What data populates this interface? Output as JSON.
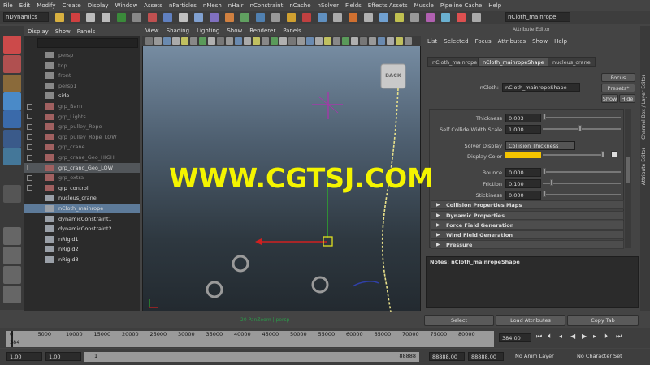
{
  "menubar": [
    "File",
    "Edit",
    "Modify",
    "Create",
    "Display",
    "Window",
    "Assets",
    "nParticles",
    "nMesh",
    "nHair",
    "nConstraint",
    "nCache",
    "nSolver",
    "Fields",
    "Effects Assets",
    "Muscle",
    "Pipeline Cache",
    "Help"
  ],
  "status": {
    "mode": "nDynamics",
    "object_field": "nCloth_mainrope"
  },
  "outliner": {
    "menu": [
      "Display",
      "Show",
      "Panels"
    ],
    "items": [
      {
        "label": "persp",
        "kind": "camera",
        "dim": true,
        "expand": false
      },
      {
        "label": "top",
        "kind": "camera",
        "dim": true,
        "expand": false
      },
      {
        "label": "front",
        "kind": "camera",
        "dim": true,
        "expand": false
      },
      {
        "label": "persp1",
        "kind": "camera",
        "dim": true,
        "expand": false
      },
      {
        "label": "side",
        "kind": "camera",
        "dim": false,
        "expand": false
      },
      {
        "label": "grp_Barn",
        "kind": "group",
        "dim": true,
        "expand": true
      },
      {
        "label": "grp_Lights",
        "kind": "group",
        "dim": true,
        "expand": true
      },
      {
        "label": "grp_pulley_Rope",
        "kind": "group",
        "dim": true,
        "expand": true
      },
      {
        "label": "grp_pulley_Rope_LOW",
        "kind": "group",
        "dim": true,
        "expand": true
      },
      {
        "label": "grp_crane",
        "kind": "group",
        "dim": true,
        "expand": true
      },
      {
        "label": "grp_crane_Geo_HIGH",
        "kind": "group",
        "dim": true,
        "expand": true
      },
      {
        "label": "grp_crand_Geo_LOW",
        "kind": "group",
        "dim": false,
        "expand": true,
        "hl": "row"
      },
      {
        "label": "grp_extra",
        "kind": "group",
        "dim": true,
        "expand": true
      },
      {
        "label": "grp_control",
        "kind": "group",
        "dim": false,
        "expand": true
      },
      {
        "label": "nucleus_crane",
        "kind": "node",
        "dim": false,
        "expand": false
      },
      {
        "label": "nCloth_mainrope",
        "kind": "node",
        "dim": false,
        "expand": false,
        "hl": "sel"
      },
      {
        "label": "dynamicConstraint1",
        "kind": "node",
        "dim": false,
        "expand": false
      },
      {
        "label": "dynamicConstraint2",
        "kind": "node",
        "dim": false,
        "expand": false
      },
      {
        "label": "nRigid1",
        "kind": "node",
        "dim": false,
        "expand": false
      },
      {
        "label": "nRigid2",
        "kind": "node",
        "dim": false,
        "expand": false
      },
      {
        "label": "nRigid3",
        "kind": "node",
        "dim": false,
        "expand": false
      }
    ]
  },
  "viewport": {
    "menu": [
      "View",
      "Shading",
      "Lighting",
      "Show",
      "Renderer",
      "Panels"
    ],
    "back_label": "BACK",
    "hud": "20 PanZoom | persp"
  },
  "attr": {
    "title": "Attribute Editor",
    "menu": [
      "List",
      "Selected",
      "Focus",
      "Attributes",
      "Show",
      "Help"
    ],
    "tabs": [
      "nCloth_mainrope",
      "nCloth_mainropeShape",
      "nucleus_crane"
    ],
    "node_label": "nCloth:",
    "node_value": "nCloth_mainropeShape",
    "focus": "Focus",
    "presets": "Presets*",
    "show": "Show",
    "hide": "Hide",
    "thickness_label": "Thickness",
    "thickness": "0.003",
    "scw_label": "Self Collide Width Scale",
    "scw": "1.000",
    "solver_label": "Solver Display",
    "solver": "Collision Thickness",
    "dcolor_label": "Display Color",
    "bounce_label": "Bounce",
    "bounce": "0.000",
    "friction_label": "Friction",
    "friction": "0.100",
    "sticky_label": "Stickiness",
    "sticky": "0.000",
    "sections": [
      "Collision Properties Maps",
      "Dynamic Properties",
      "Force Field Generation",
      "Wind Field Generation",
      "Pressure"
    ],
    "notes": "Notes:  nCloth_mainropeShape",
    "select": "Select",
    "load": "Load Attributes",
    "copy": "Copy Tab"
  },
  "side_tabs": [
    "Channel Box / Layer Editor",
    "Attribute Editor"
  ],
  "timeline": {
    "ticks": [
      "0",
      "5000",
      "10000",
      "15000",
      "20000",
      "25000",
      "30000",
      "35000",
      "40000",
      "45000",
      "50000",
      "55000",
      "60000",
      "65000",
      "70000",
      "75000",
      "80000"
    ],
    "current": "384",
    "current_field": "384.00"
  },
  "range": {
    "start": "1.00",
    "start2": "1.00",
    "range_start": "1",
    "range_end": "88888",
    "end1": "88888.00",
    "end2": "88888.00",
    "anim_layer": "No Anim Layer",
    "char_set": "No Character Set"
  },
  "watermark": "WWW.CGTSJ.COM",
  "colors": {
    "display_color": "#f5c400",
    "watermark": "#f4f400",
    "selected_row": "#5d7a99",
    "hl_row": "#52565a"
  }
}
